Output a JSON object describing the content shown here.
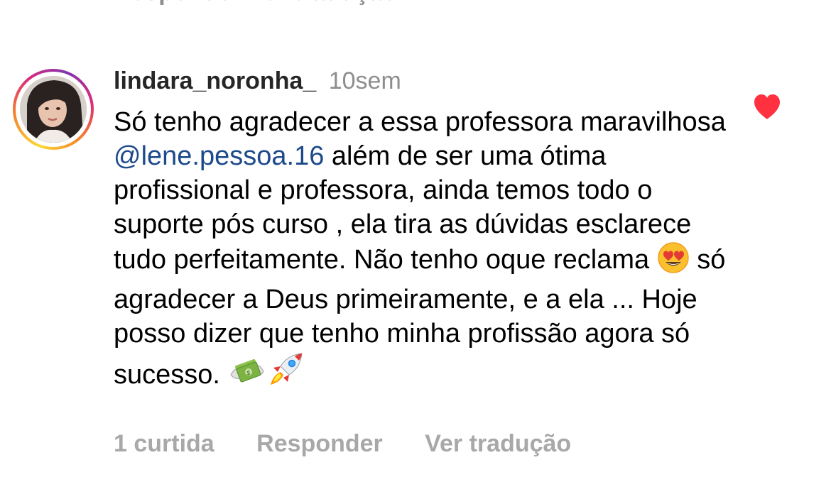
{
  "previous_comment": {
    "actions_text": "Responder    Ver tradução"
  },
  "comment": {
    "username": "lindara_noronha_",
    "time": "10sem",
    "text_segments": {
      "part1": "Só tenho agradecer a essa professora maravilhosa ",
      "mention": "@lene.pessoa.16",
      "part2": " além de ser uma ótima profissional e professora, ainda temos todo o suporte pós curso , ela tira as dúvidas esclarece tudo perfeitamente. Não tenho oque reclama ",
      "part3": " só agradecer a Deus primeiramente, e a ela ... Hoje posso dizer que tenho minha profissão agora  só sucesso. "
    },
    "emojis": [
      "heart-eyes-emoji",
      "money-with-wings-emoji",
      "rocket-emoji"
    ],
    "actions": {
      "likes": "1 curtida",
      "reply": "Responder",
      "translate": "Ver tradução"
    },
    "liked": true
  },
  "colors": {
    "mention": "#1c4a8a",
    "heart": "#ff3040",
    "muted": "#8e8e8e"
  }
}
